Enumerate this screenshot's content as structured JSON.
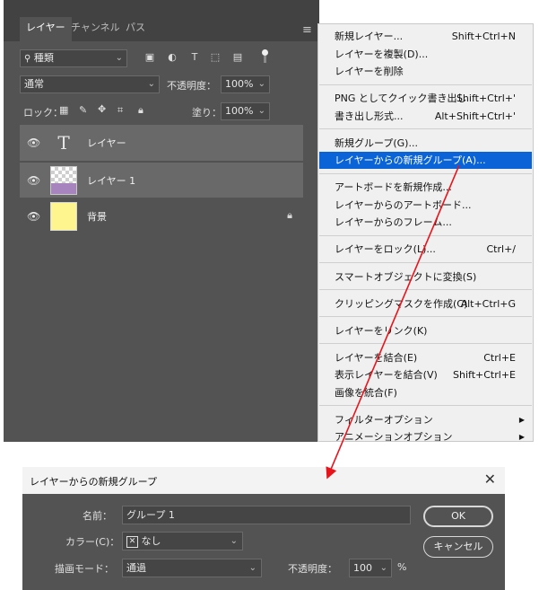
{
  "layers_panel": {
    "tabs": [
      "レイヤー",
      "チャンネル",
      "パス"
    ],
    "menu_icon": "hamburger-icon",
    "filter": {
      "kind": "種類"
    },
    "blend_mode": "通常",
    "opacity_label": "不透明度：",
    "opacity_value": "100%",
    "lock_label": "ロック：",
    "fill_label": "塗り：",
    "fill_value": "100%",
    "layers": [
      {
        "name": "レイヤー",
        "type": "text",
        "selected": true
      },
      {
        "name": "レイヤー 1",
        "type": "pixel",
        "selected": true
      },
      {
        "name": "背景",
        "type": "background",
        "selected": false,
        "locked": true
      }
    ]
  },
  "context_menu": {
    "groups": [
      [
        {
          "label": "新規レイヤー...",
          "shortcut": "Shift+Ctrl+N"
        },
        {
          "label": "レイヤーを複製(D)...",
          "shortcut": ""
        },
        {
          "label": "レイヤーを削除",
          "shortcut": ""
        }
      ],
      [
        {
          "label": "PNG としてクイック書き出し",
          "shortcut": "Shift+Ctrl+'"
        },
        {
          "label": "書き出し形式...",
          "shortcut": "Alt+Shift+Ctrl+'"
        }
      ],
      [
        {
          "label": "新規グループ(G)...",
          "shortcut": ""
        },
        {
          "label": "レイヤーからの新規グループ(A)...",
          "shortcut": "",
          "highlighted": true
        }
      ],
      [
        {
          "label": "アートボードを新規作成...",
          "shortcut": ""
        },
        {
          "label": "レイヤーからのアートボード...",
          "shortcut": ""
        },
        {
          "label": "レイヤーからのフレーム...",
          "shortcut": ""
        }
      ],
      [
        {
          "label": "レイヤーをロック(L)...",
          "shortcut": "Ctrl+/"
        }
      ],
      [
        {
          "label": "スマートオブジェクトに変換(S)",
          "shortcut": ""
        }
      ],
      [
        {
          "label": "クリッピングマスクを作成(C)",
          "shortcut": "Alt+Ctrl+G"
        }
      ],
      [
        {
          "label": "レイヤーをリンク(K)",
          "shortcut": ""
        }
      ],
      [
        {
          "label": "レイヤーを結合(E)",
          "shortcut": "Ctrl+E"
        },
        {
          "label": "表示レイヤーを結合(V)",
          "shortcut": "Shift+Ctrl+E"
        },
        {
          "label": "画像を統合(F)",
          "shortcut": ""
        }
      ],
      [
        {
          "label": "フィルターオプション",
          "shortcut": "",
          "submenu": true
        },
        {
          "label": "アニメーションオプション",
          "shortcut": "",
          "submenu": true
        }
      ]
    ]
  },
  "dialog": {
    "title": "レイヤーからの新規グループ",
    "name_label": "名前：",
    "name_value": "グループ 1",
    "color_label": "カラー(C)：",
    "color_value": "なし",
    "mode_label": "描画モード：",
    "mode_value": "通過",
    "opacity_label": "不透明度：",
    "opacity_value": "100",
    "opacity_unit": "%",
    "ok_label": "OK",
    "cancel_label": "キャンセル"
  },
  "colors": {
    "highlight": "#0a64d8",
    "arrow": "#e8141c",
    "panel": "#535353"
  }
}
